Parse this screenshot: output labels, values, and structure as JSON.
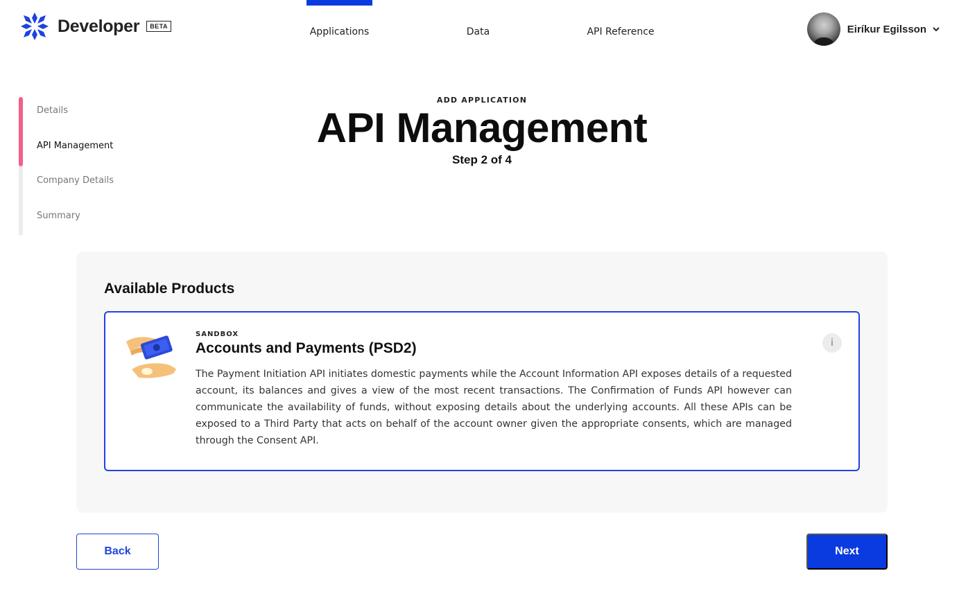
{
  "header": {
    "logo_text": "Developer",
    "beta_badge": "BETA",
    "nav": [
      {
        "label": "Applications",
        "active": true
      },
      {
        "label": "Data",
        "active": false
      },
      {
        "label": "API Reference",
        "active": false
      }
    ],
    "user_name": "Eiríkur Egilsson"
  },
  "stepper": {
    "steps": [
      "Details",
      "API Management",
      "Company Details",
      "Summary"
    ],
    "current_index": 1
  },
  "page": {
    "kicker": "ADD APPLICATION",
    "title": "API Management",
    "subtitle": "Step 2 of 4"
  },
  "products": {
    "heading": "Available Products",
    "items": [
      {
        "kicker": "SANDBOX",
        "title": "Accounts and Payments (PSD2)",
        "description": "The Payment Initiation API initiates domestic payments while the Account Information API exposes details of a requested account, its balances and gives a view of the most recent transactions. The Confirmation of Funds API however can communicate the availability of funds, without exposing details about the underlying accounts. All these APIs can be exposed to a Third Party that acts on behalf of the account owner given the appropriate consents, which are managed through the Consent API.",
        "info_icon_label": "i"
      }
    ]
  },
  "footer": {
    "back_label": "Back",
    "next_label": "Next"
  },
  "colors": {
    "accent": "#0a3be0",
    "step_progress": "#f0608a",
    "panel_bg": "#f7f7f7"
  },
  "icons": {
    "logo": "star-logo-icon",
    "user_menu": "chevron-down-icon",
    "product": "money-hands-icon",
    "info": "info-icon"
  }
}
